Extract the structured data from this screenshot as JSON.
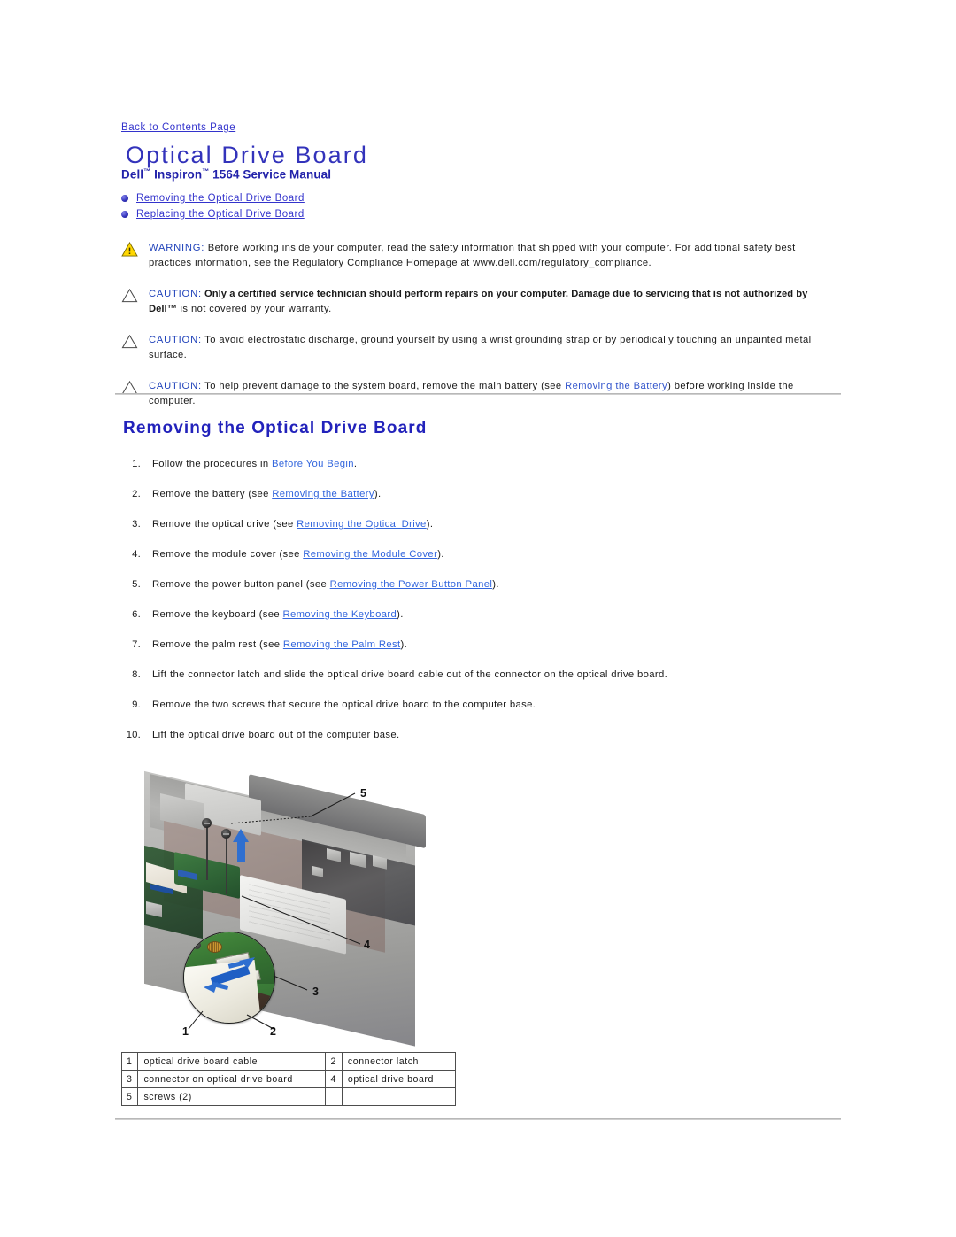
{
  "backlink": {
    "label": "Back to Contents Page"
  },
  "header": {
    "title": "Optical Drive Board",
    "subtitle_pre": "Dell",
    "subtitle_tm1": "™",
    "subtitle_mid": " Inspiron",
    "subtitle_tm2": "™",
    "subtitle_post": " 1564 Service Manual"
  },
  "toc": {
    "items": [
      {
        "label": "Removing the Optical Drive Board"
      },
      {
        "label": "Replacing the Optical Drive Board"
      }
    ]
  },
  "notices": [
    {
      "icon": "warning-triangle-icon",
      "lead": "WARNING:",
      "body": " Before working inside your computer, read the safety information that shipped with your computer. For additional safety best practices information, see the Regulatory Compliance Homepage at www.dell.com/regulatory_compliance."
    },
    {
      "icon": "caution-triangle-icon",
      "lead": "CAUTION:",
      "bold": " Only a certified service technician should perform repairs on your computer. Damage due to servicing that is not authorized by Dell™",
      "body": " is not covered by your warranty."
    },
    {
      "icon": "caution-triangle-icon",
      "lead": "CAUTION:",
      "body": " To avoid electrostatic discharge, ground yourself by using a wrist grounding strap or by periodically touching an unpainted metal surface."
    },
    {
      "icon": "caution-triangle-icon",
      "lead": "CAUTION:",
      "body_pre": " To help prevent damage to the system board, remove the main battery (see ",
      "link": "Removing the Battery",
      "body_post": ") before working inside the computer."
    }
  ],
  "section": {
    "heading": "Removing the Optical Drive Board"
  },
  "steps": [
    {
      "num": "1.",
      "pre": "Follow the procedures in ",
      "link": "Before You Begin",
      "post": "."
    },
    {
      "num": "2.",
      "pre": "Remove the battery (see ",
      "link": "Removing the Battery",
      "post": ")."
    },
    {
      "num": "3.",
      "pre": "Remove the optical drive (see ",
      "link": "Removing the Optical Drive",
      "post": ")."
    },
    {
      "num": "4.",
      "pre": "Remove the module cover (see ",
      "link": "Removing the Module Cover",
      "post": ")."
    },
    {
      "num": "5.",
      "pre": "Remove the power button panel (see ",
      "link": "Removing the Power Button Panel",
      "post": ")."
    },
    {
      "num": "6.",
      "pre": "Remove the keyboard (see ",
      "link": "Removing the Keyboard",
      "post": ")."
    },
    {
      "num": "7.",
      "pre": "Remove the palm rest (see ",
      "link": "Removing the Palm Rest",
      "post": ")."
    },
    {
      "num": "8.",
      "pre": "Lift the connector latch and slide the optical drive board cable out of the connector on the optical drive board.",
      "link": "",
      "post": ""
    },
    {
      "num": "9.",
      "pre": "Remove the two screws that secure the optical drive board to the computer base.",
      "link": "",
      "post": ""
    },
    {
      "num": "10.",
      "pre": "Lift the optical drive board out of the computer base.",
      "link": "",
      "post": ""
    }
  ],
  "figure": {
    "callouts": [
      {
        "id": "1"
      },
      {
        "id": "2"
      },
      {
        "id": "3"
      },
      {
        "id": "4"
      },
      {
        "id": "5"
      }
    ]
  },
  "legend": {
    "rows": [
      {
        "k1": "1",
        "v1": "optical drive board cable",
        "k2": "2",
        "v2": "connector latch"
      },
      {
        "k1": "3",
        "v1": "connector on optical drive board",
        "k2": "4",
        "v2": "optical drive board"
      },
      {
        "k1": "5",
        "v1": "screws (2)",
        "k2": "",
        "v2": ""
      }
    ]
  },
  "colors": {
    "link": "#3333cc",
    "title": "#3333bb",
    "heading": "#2222bb",
    "warning_yellow": "#ffd700",
    "rule": "#cfcfcf"
  }
}
